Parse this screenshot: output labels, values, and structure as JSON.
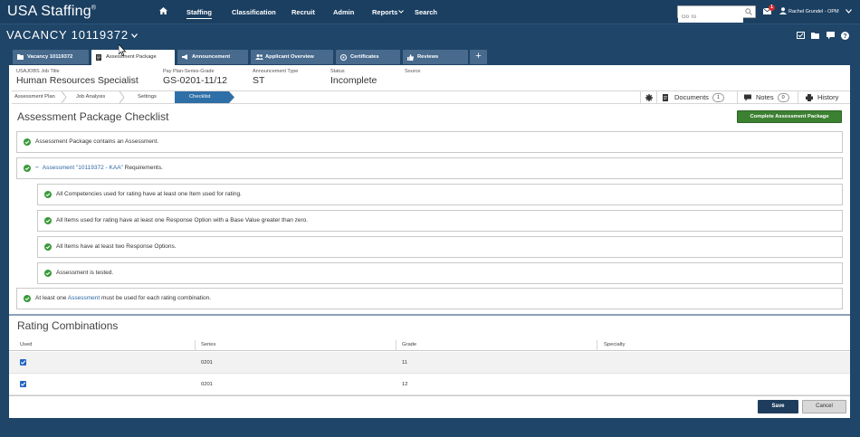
{
  "app": {
    "logo": "USA Staffing",
    "logo_mark": "®",
    "nav": [
      {
        "label": "Staffing"
      },
      {
        "label": "Classification"
      },
      {
        "label": "Recruit"
      },
      {
        "label": "Admin"
      },
      {
        "label": "Reports"
      },
      {
        "label": "Search"
      }
    ],
    "goto_placeholder": "Go To",
    "mail_badge": "1",
    "user_name": "Rachel Grundel - OPM"
  },
  "page": {
    "title": "VACANCY 10119372",
    "tabs": [
      {
        "label": "Vacancy 10119372",
        "icon": "folder-icon"
      },
      {
        "label": "Assessment Package",
        "icon": "document-icon"
      },
      {
        "label": "Announcement",
        "icon": "megaphone-icon"
      },
      {
        "label": "Applicant Overview",
        "icon": "users-icon"
      },
      {
        "label": "Certificates",
        "icon": "certificate-icon"
      },
      {
        "label": "Reviews",
        "icon": "thumbs-up-icon"
      }
    ],
    "add_tab": "+"
  },
  "info": {
    "job_title_label": "USAJOBS Job Title",
    "job_title": "Human Resources Specialist",
    "pay_label": "Pay Plan-Series-Grade",
    "pay": "GS-0201-11/12",
    "type_label": "Announcement Type",
    "type": "ST",
    "status_label": "Status",
    "status": "Incomplete",
    "source_label": "Source"
  },
  "crumbs": {
    "steps": [
      "Assessment Plan",
      "Job Analysis",
      "Settings",
      "Checklist"
    ],
    "documents": "Documents",
    "documents_count": "1",
    "notes": "Notes",
    "notes_count": "0",
    "history": "History"
  },
  "checklist": {
    "title": "Assessment Package Checklist",
    "complete_button": "Complete Assessment Package",
    "item1": "Assessment Package contains an Assessment.",
    "item2_toggle": "−",
    "item2_link": "Assessment \"10119372 - KAA\"",
    "item2_rest": " Requirements.",
    "sub": [
      "All Competencies used for rating have at least one Item used for rating.",
      "All Items used for rating have at least one Response Option with a Base Value greater than zero.",
      "All Items have at least two Response Options.",
      "Assessment is tested."
    ],
    "item3_pre": "At least one ",
    "item3_link": "Assessment",
    "item3_post": " must be used for each rating combination."
  },
  "rating": {
    "title": "Rating Combinations",
    "headers": [
      "Used",
      "Series",
      "Grade",
      "Specialty"
    ],
    "rows": [
      {
        "used": true,
        "series": "0201",
        "grade": "11",
        "specialty": ""
      },
      {
        "used": true,
        "series": "0201",
        "grade": "12",
        "specialty": ""
      }
    ]
  },
  "footer": {
    "save": "Save",
    "cancel": "Cancel"
  },
  "colors": {
    "nav_bg": "#1b3f61",
    "page_bg": "#1f4568",
    "tab_bg": "#476a8d",
    "active_step": "#2f6fa7",
    "success": "#3c8032",
    "check": "#3a9a3a",
    "link": "#2c67a1"
  }
}
